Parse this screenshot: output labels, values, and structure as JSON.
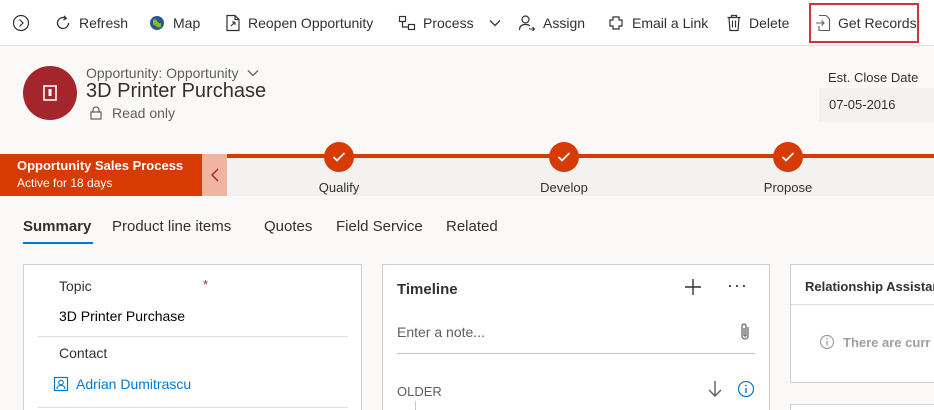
{
  "toolbar": {
    "refresh": "Refresh",
    "map": "Map",
    "reopen": "Reopen Opportunity",
    "process": "Process",
    "assign": "Assign",
    "email_link": "Email a Link",
    "delete": "Delete",
    "get_records": "Get Records"
  },
  "header": {
    "entity": "Opportunity: Opportunity",
    "title": "3D Printer Purchase",
    "readonly": "Read only",
    "close_date_label": "Est. Close Date",
    "close_date_value": "07-05-2016"
  },
  "process": {
    "name": "Opportunity Sales Process",
    "duration": "Active for 18 days",
    "stages": [
      "Qualify",
      "Develop",
      "Propose"
    ],
    "accent": "#d83b01"
  },
  "tabs": [
    "Summary",
    "Product line items",
    "Quotes",
    "Field Service",
    "Related"
  ],
  "summary": {
    "topic_label": "Topic",
    "required_mark": "*",
    "topic_value": "3D Printer Purchase",
    "contact_label": "Contact",
    "contact_value": "Adrian Dumitrascu"
  },
  "timeline": {
    "title": "Timeline",
    "more": "···",
    "note_placeholder": "Enter a note...",
    "older": "OLDER"
  },
  "assistant": {
    "title": "Relationship Assistant",
    "empty": "There are curr"
  },
  "colors": {
    "highlight_box": "#d13438",
    "avatar": "#a4262c",
    "link": "#0078d4"
  },
  "icons": [
    "expand-icon",
    "refresh-icon",
    "map-icon",
    "reopen-icon",
    "process-icon",
    "chevron-down-icon",
    "assign-icon",
    "email-link-icon",
    "delete-icon",
    "get-records-icon",
    "lock-icon",
    "checkmark-icon",
    "chevron-left-icon",
    "plus-icon",
    "more-icon",
    "paperclip-icon",
    "arrow-down-icon",
    "info-icon",
    "contact-icon"
  ]
}
